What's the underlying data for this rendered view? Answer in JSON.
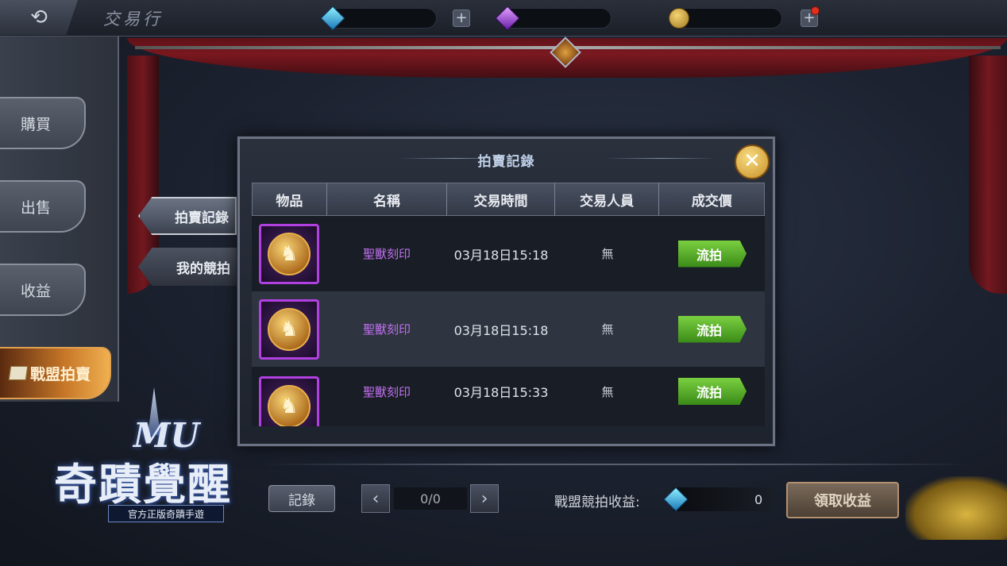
{
  "header": {
    "back_icon": "back-arrow-icon",
    "title": "交易行",
    "currencies": [
      {
        "icon": "blue-diamond-icon",
        "color": "#2aa8e0"
      },
      {
        "icon": "purple-crystal-icon",
        "color": "#9a3ae0"
      },
      {
        "icon": "gold-coin-icon",
        "color": "#e0b840"
      }
    ],
    "plus_label": "+"
  },
  "nav": {
    "items": [
      {
        "label": "購買"
      },
      {
        "label": "出售"
      },
      {
        "label": "收益"
      },
      {
        "label": "戰盟拍賣",
        "active": true
      }
    ]
  },
  "subtabs": [
    {
      "label": "拍賣記錄",
      "active": true
    },
    {
      "label": "我的競拍",
      "active": false
    }
  ],
  "modal": {
    "title": "拍賣記錄",
    "close_label": "✕",
    "columns": [
      "物品",
      "名稱",
      "交易時間",
      "交易人員",
      "成交價"
    ],
    "rows": [
      {
        "item_icon": "horse-medal-icon",
        "name": "聖獸刻印",
        "time": "03月18日15:18",
        "trader": "無",
        "status": "流拍"
      },
      {
        "item_icon": "horse-medal-icon",
        "name": "聖獸刻印",
        "time": "03月18日15:18",
        "trader": "無",
        "status": "流拍"
      },
      {
        "item_icon": "horse-medal-icon",
        "name": "聖獸刻印",
        "time": "03月18日15:33",
        "trader": "無",
        "status": "流拍"
      }
    ]
  },
  "footer": {
    "record_label": "記錄",
    "prev_label": "‹",
    "next_label": "›",
    "page": "0/0",
    "income_label": "戰盟競拍收益:",
    "income_value": "0",
    "claim_label": "領取收益"
  },
  "logo": {
    "brand": "MU",
    "name": "奇蹟覺醒",
    "tagline": "官方正版奇蹟手遊"
  }
}
